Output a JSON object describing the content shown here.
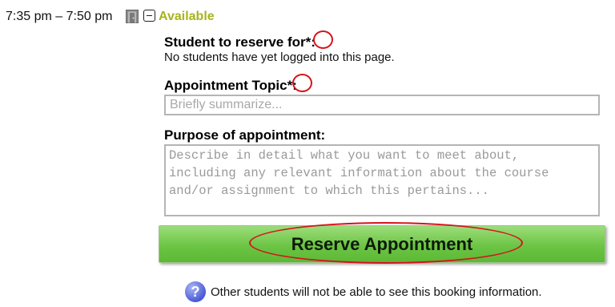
{
  "slot": {
    "time_range": "7:35 pm – 7:50 pm",
    "status": "Available",
    "status_color": "#a6b51c",
    "icons": [
      "door-icon",
      "collapse-icon"
    ]
  },
  "form": {
    "student_label": "Student to reserve for",
    "student_note": "No students have yet logged into this page.",
    "topic_label": "Appointment Topic",
    "topic_placeholder": "Briefly summarize...",
    "topic_value": "",
    "purpose_label": "Purpose of appointment:",
    "purpose_placeholder": "Describe in detail what you want to meet about,\nincluding any relevant information about the course\nand/or assignment to which this pertains...",
    "purpose_value": "",
    "required_marker": "*:",
    "submit_label": "Reserve Appointment",
    "submit_color": "#6cc544"
  },
  "footer": {
    "info_icon": "question-icon",
    "info_text": "Other students will not be able to see this booking information."
  },
  "annotation_color": "#d4141c"
}
